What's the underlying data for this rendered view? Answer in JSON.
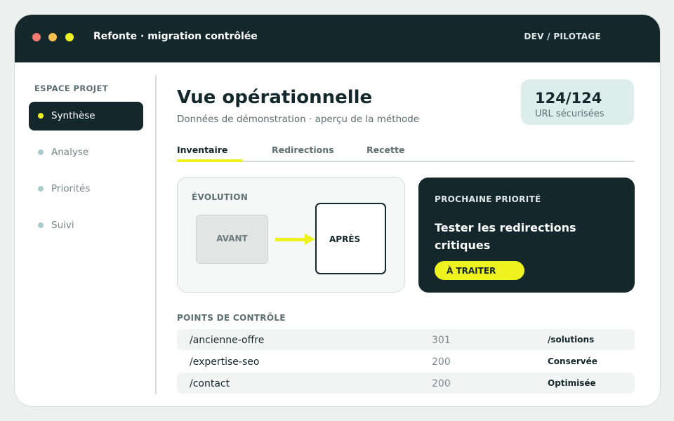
{
  "window": {
    "title": "Refonte · migration contrôlée",
    "context": "DEV / PILOTAGE"
  },
  "sidebar": {
    "title": "ESPACE PROJET",
    "items": [
      {
        "label": "Synthèse",
        "active": true
      },
      {
        "label": "Analyse",
        "active": false
      },
      {
        "label": "Priorités",
        "active": false
      },
      {
        "label": "Suivi",
        "active": false
      }
    ]
  },
  "header": {
    "title": "Vue opérationnelle",
    "subtitle": "Données de démonstration · aperçu de la méthode"
  },
  "stat": {
    "value": "124/124",
    "label": "URL sécurisées"
  },
  "tabs": [
    {
      "label": "Inventaire",
      "active": true
    },
    {
      "label": "Redirections",
      "active": false
    },
    {
      "label": "Recette",
      "active": false
    }
  ],
  "evolution": {
    "title": "ÉVOLUTION",
    "before": "AVANT",
    "after": "APRÈS"
  },
  "priority": {
    "title": "PROCHAINE PRIORITÉ",
    "text": "Tester les redirections critiques",
    "button": "À TRAITER"
  },
  "checkpoints": {
    "title": "POINTS DE CONTRÔLE",
    "rows": [
      {
        "path": "/ancienne-offre",
        "code": "301",
        "status": "/solutions"
      },
      {
        "path": "/expertise-seo",
        "code": "200",
        "status": "Conservée"
      },
      {
        "path": "/contact",
        "code": "200",
        "status": "Optimisée"
      }
    ]
  },
  "colors": {
    "dark": "#14282c",
    "accent": "#eef21f",
    "stat_bg": "#dcedec"
  }
}
